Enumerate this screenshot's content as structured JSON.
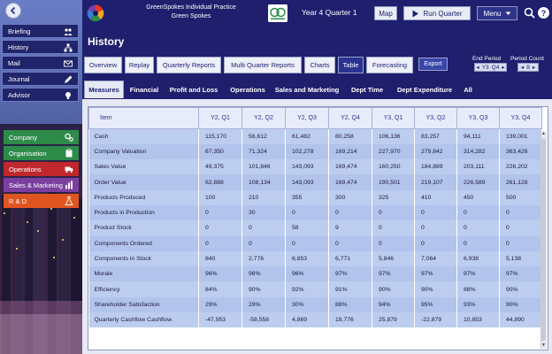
{
  "app": {
    "practice_line1": "GreenSpokes Individual Practice",
    "practice_line2": "Green Spokes",
    "period": "Year 4 Quarter 1"
  },
  "toolbar": {
    "map_label": "Map",
    "run_label": "Run Quarter",
    "menu_label": "Menu",
    "help_label": "?"
  },
  "sidebar": {
    "nav": [
      {
        "label": "Briefing",
        "icon": "people-icon"
      },
      {
        "label": "History",
        "icon": "diagram-icon"
      },
      {
        "label": "Mail",
        "icon": "envelope-icon"
      },
      {
        "label": "Journal",
        "icon": "pencil-icon"
      },
      {
        "label": "Advisor",
        "icon": "lightbulb-icon"
      }
    ],
    "functions": [
      {
        "label": "Company",
        "icon": "gears-icon",
        "color": "#2e8b4a"
      },
      {
        "label": "Organisation",
        "icon": "clipboard-icon",
        "color": "#2e8b4a"
      },
      {
        "label": "Operations",
        "icon": "truck-icon",
        "color": "#c0282d"
      },
      {
        "label": "Sales & Marketing",
        "icon": "barchart-icon",
        "color": "#7b3fa0"
      },
      {
        "label": "R & D",
        "icon": "flask-icon",
        "color": "#e0551f"
      }
    ]
  },
  "page": {
    "title": "History"
  },
  "tabs1": [
    {
      "label": "Overview",
      "active": false
    },
    {
      "label": "Replay",
      "active": false
    },
    {
      "label": "Quarterly Reports",
      "active": false
    },
    {
      "label": "Multi Quarter Reports",
      "active": false
    },
    {
      "label": "Charts",
      "active": false
    },
    {
      "label": "Table",
      "active": true
    },
    {
      "label": "Forecasting",
      "active": false
    }
  ],
  "export_label": "Export",
  "end_period": {
    "label": "End Period",
    "year": "Y3",
    "quarter": "Q4"
  },
  "period_count": {
    "label": "Period Count",
    "value": "8"
  },
  "tabs2": [
    {
      "label": "Measures",
      "active": true
    },
    {
      "label": "Financial",
      "active": false
    },
    {
      "label": "Profit and Loss",
      "active": false
    },
    {
      "label": "Operations",
      "active": false
    },
    {
      "label": "Sales and Marketing",
      "active": false
    },
    {
      "label": "Dept Time",
      "active": false
    },
    {
      "label": "Dept Expenditure",
      "active": false
    },
    {
      "label": "All",
      "active": false
    }
  ],
  "table": {
    "headers": [
      "Item",
      "Y2, Q1",
      "Y2, Q2",
      "Y2, Q3",
      "Y2, Q4",
      "Y3, Q1",
      "Y3, Q2",
      "Y3, Q3",
      "Y3, Q4"
    ],
    "rows": [
      [
        "Cash",
        "115,170",
        "56,612",
        "61,482",
        "80,258",
        "106,136",
        "83,257",
        "94,111",
        "139,001"
      ],
      [
        "Company Valuation",
        "67,350",
        "71,324",
        "102,278",
        "169,214",
        "227,970",
        "279,842",
        "314,282",
        "363,426"
      ],
      [
        "Sales Value",
        "49,375",
        "101,846",
        "143,093",
        "169,474",
        "160,250",
        "184,889",
        "203,111",
        "226,202"
      ],
      [
        "Order Value",
        "62,888",
        "108,134",
        "143,093",
        "169,474",
        "190,501",
        "219,107",
        "226,589",
        "261,128"
      ],
      [
        "Products Produced",
        "100",
        "210",
        "355",
        "300",
        "325",
        "410",
        "450",
        "500"
      ],
      [
        "Products in Production",
        "0",
        "30",
        "0",
        "0",
        "0",
        "0",
        "0",
        "0"
      ],
      [
        "Product Stock",
        "0",
        "0",
        "58",
        "9",
        "0",
        "0",
        "0",
        "0"
      ],
      [
        "Components Ordered",
        "0",
        "0",
        "0",
        "0",
        "0",
        "0",
        "0",
        "0"
      ],
      [
        "Components in Stock",
        "840",
        "2,776",
        "6,853",
        "6,771",
        "5,846",
        "7,064",
        "6,938",
        "5,138"
      ],
      [
        "Morale",
        "96%",
        "96%",
        "96%",
        "97%",
        "97%",
        "97%",
        "97%",
        "97%"
      ],
      [
        "Efficiency",
        "84%",
        "90%",
        "92%",
        "91%",
        "90%",
        "90%",
        "88%",
        "90%"
      ],
      [
        "Shareholder Satisfaction",
        "29%",
        "29%",
        "30%",
        "88%",
        "94%",
        "95%",
        "93%",
        "90%"
      ],
      [
        "Quarterly Cashflow Cashflow",
        "-47,953",
        "-58,558",
        "4,869",
        "18,776",
        "25,879",
        "-22,879",
        "10,853",
        "44,890"
      ]
    ]
  }
}
